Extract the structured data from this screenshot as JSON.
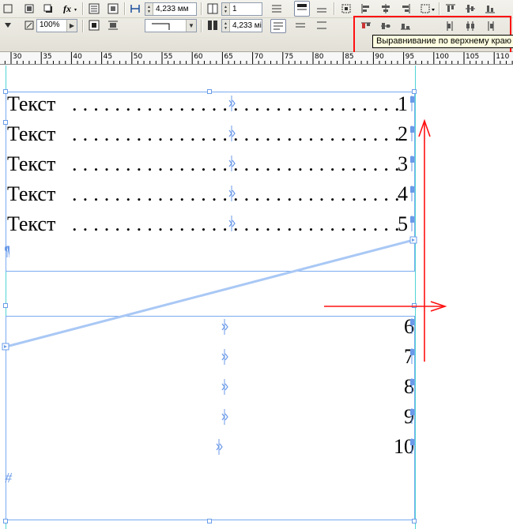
{
  "toolbar": {
    "row1": {
      "dimension_value": "4,233 мм",
      "columns_value": "1"
    },
    "row2": {
      "zoom_value": "100%",
      "gutter_value": "4,233 мі"
    },
    "tooltip": "Выравнивание по верхнему краю"
  },
  "ruler": {
    "labels": [
      "30",
      "35",
      "40",
      "45",
      "50",
      "55",
      "60",
      "65",
      "70",
      "75",
      "80",
      "85",
      "90",
      "95",
      "100",
      "105",
      "110"
    ]
  },
  "document": {
    "toc_entries": [
      {
        "text": "Текст",
        "leader": "................................................",
        "page": "1"
      },
      {
        "text": "Текст",
        "leader": "................................................",
        "page": "2"
      },
      {
        "text": "Текст",
        "leader": "................................................",
        "page": "3"
      },
      {
        "text": "Текст",
        "leader": "................................................",
        "page": "4"
      },
      {
        "text": "Текст",
        "leader": "................................................",
        "page": "5"
      }
    ],
    "second_frame_pages": [
      "6",
      "7",
      "8",
      "9",
      "10"
    ],
    "end_marker": "#"
  },
  "colors": {
    "frame": "#79aaf0",
    "guide": "#50d4d4",
    "annotation_red": "#ff1010",
    "tab_marker": "#6b9ae8"
  }
}
